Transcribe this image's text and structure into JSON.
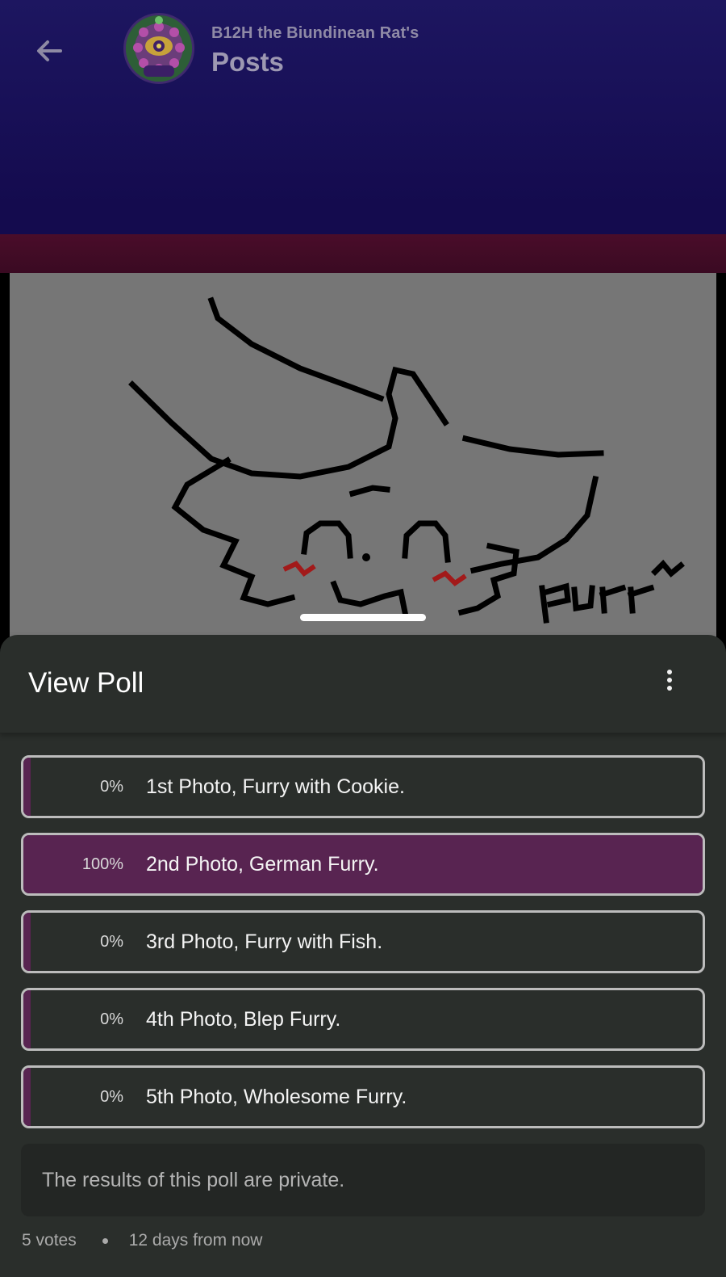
{
  "header": {
    "community_name": "B12H the Biundinean Rat's",
    "title": "Posts",
    "back_icon": "arrow-left-icon",
    "avatar_icon": "community-avatar"
  },
  "drawing": {
    "icon": "furry-sketch-image",
    "caption": "purr~"
  },
  "sheet": {
    "title": "View Poll",
    "menu_icon": "more-vertical-icon"
  },
  "poll": {
    "options": [
      {
        "percent": "0%",
        "label": "1st Photo, Furry with Cookie.",
        "fill": 0.0
      },
      {
        "percent": "100%",
        "label": "2nd Photo, German Furry.",
        "fill": 1.0
      },
      {
        "percent": "0%",
        "label": "3rd Photo, Furry with Fish.",
        "fill": 0.0
      },
      {
        "percent": "0%",
        "label": "4th Photo, Blep Furry.",
        "fill": 0.0
      },
      {
        "percent": "0%",
        "label": "5th Photo, Wholesome Furry.",
        "fill": 0.0
      }
    ],
    "private_notice": "The results of this poll are private.",
    "votes": "5 votes",
    "expires": "12 days from now"
  },
  "colors": {
    "header_bg": "#181057",
    "accent_fill": "#582451",
    "sheet_bg": "#2a2e2b",
    "option_border": "#bcbcbc"
  }
}
